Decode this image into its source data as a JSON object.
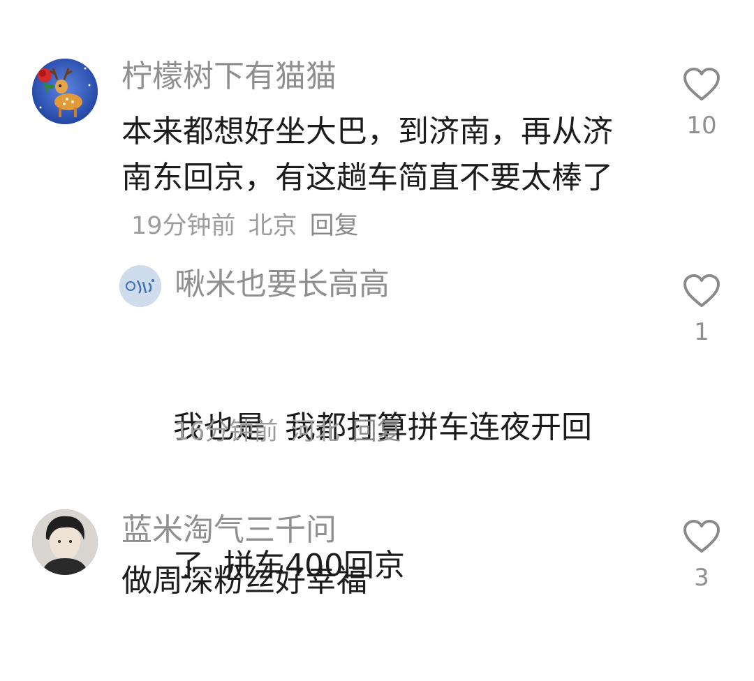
{
  "comments": [
    {
      "username": "柠檬树下有猫猫",
      "text": "本来都想好坐大巴，到济南，再从济南东回京，有这趟车简直不要太棒了",
      "time": "19分钟前",
      "location": "北京",
      "reply_label": "回复",
      "likes": "10",
      "avatar_icon": "deer-rose-icon",
      "avatar_color": "#3b63c9"
    },
    {
      "username": "啾米也要长高高",
      "text_line1": "我也是  我都打算拼车连夜开回",
      "text_line2": "了  拼车400回京",
      "time": "16分钟前",
      "location": "河北",
      "reply_label": "回复",
      "likes": "1",
      "avatar_icon": "blue-doodle-icon",
      "avatar_color": "#b9cfe8"
    },
    {
      "username": "蓝米淘气三千问",
      "text": "做周深粉丝好幸福",
      "likes": "3",
      "avatar_icon": "person-photo-icon",
      "avatar_color": "#3a3a3a"
    }
  ],
  "colors": {
    "username": "#8f8f8f",
    "text": "#1c1c1c",
    "meta": "#9c9c9c",
    "heart_stroke": "#8a8a8a"
  }
}
